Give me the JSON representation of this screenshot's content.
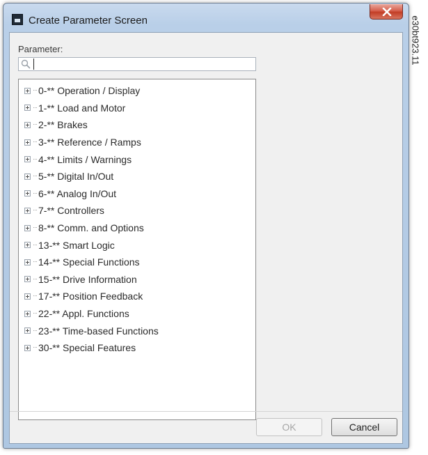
{
  "window": {
    "title": "Create Parameter Screen",
    "close_label": "X"
  },
  "parameter_label": "Parameter:",
  "search": {
    "value": "",
    "placeholder": ""
  },
  "tree": {
    "items": [
      {
        "label": "0-** Operation / Display"
      },
      {
        "label": "1-** Load and Motor"
      },
      {
        "label": "2-** Brakes"
      },
      {
        "label": "3-** Reference / Ramps"
      },
      {
        "label": "4-** Limits / Warnings"
      },
      {
        "label": "5-** Digital In/Out"
      },
      {
        "label": "6-** Analog In/Out"
      },
      {
        "label": "7-** Controllers"
      },
      {
        "label": "8-** Comm. and Options"
      },
      {
        "label": "13-** Smart Logic"
      },
      {
        "label": "14-** Special Functions"
      },
      {
        "label": "15-** Drive Information"
      },
      {
        "label": "17-** Position Feedback"
      },
      {
        "label": "22-** Appl. Functions"
      },
      {
        "label": "23-** Time-based Functions"
      },
      {
        "label": "30-** Special Features"
      }
    ]
  },
  "buttons": {
    "ok_label": "OK",
    "ok_enabled": false,
    "cancel_label": "Cancel"
  },
  "figure_code": "e30bt923.11",
  "colors": {
    "titlebar": "#b9cfe8",
    "close_button": "#c94a35",
    "client_background": "#f0f0f0"
  },
  "icons": {
    "app": "app-icon",
    "close": "close-icon",
    "search": "search-icon",
    "expand": "plus-box-icon"
  }
}
